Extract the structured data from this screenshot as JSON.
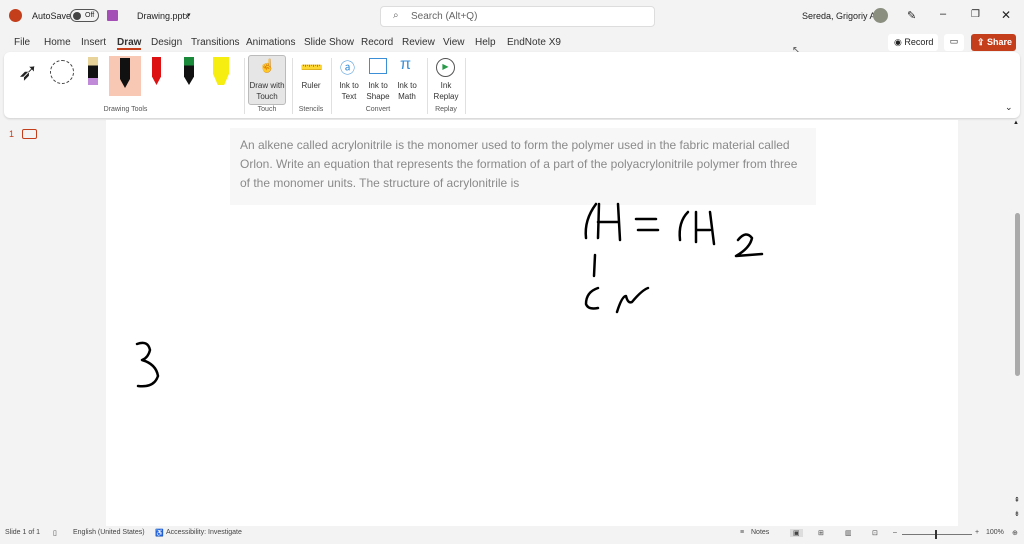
{
  "titlebar": {
    "autosave": "AutoSave",
    "toggle": "Off",
    "filename": "Drawing.pptx",
    "search_placeholder": "Search (Alt+Q)",
    "user": "Sereda, Grigoriy A"
  },
  "tabs": [
    "File",
    "Home",
    "Insert",
    "Draw",
    "Design",
    "Transitions",
    "Animations",
    "Slide Show",
    "Record",
    "Review",
    "View",
    "Help",
    "EndNote X9"
  ],
  "actions": {
    "record": "Record",
    "share": "Share"
  },
  "ribbon": {
    "draw_with_touch": "Draw with Touch",
    "ruler": "Ruler",
    "ink_to_text": "Ink to Text",
    "ink_to_shape": "Ink to Shape",
    "ink_to_math": "Ink to Math",
    "ink_replay": "Ink Replay",
    "groups": {
      "drawing_tools": "Drawing Tools",
      "touch": "Touch",
      "stencils": "Stencils",
      "convert": "Convert",
      "replay": "Replay"
    }
  },
  "thumbnail_number": "1",
  "slide": {
    "prompt": "An alkene called acrylonitrile is the monomer used to form the polymer used in the fabric material called Orlon. Write an equation that represents the formation of a part of the polyacrylonitrile polymer from three of the monomer units. The structure of acrylonitrile is"
  },
  "status": {
    "slide": "Slide 1 of 1",
    "language": "English (United States)",
    "accessibility": "Accessibility: Investigate",
    "notes": "Notes",
    "zoom": "100%"
  }
}
